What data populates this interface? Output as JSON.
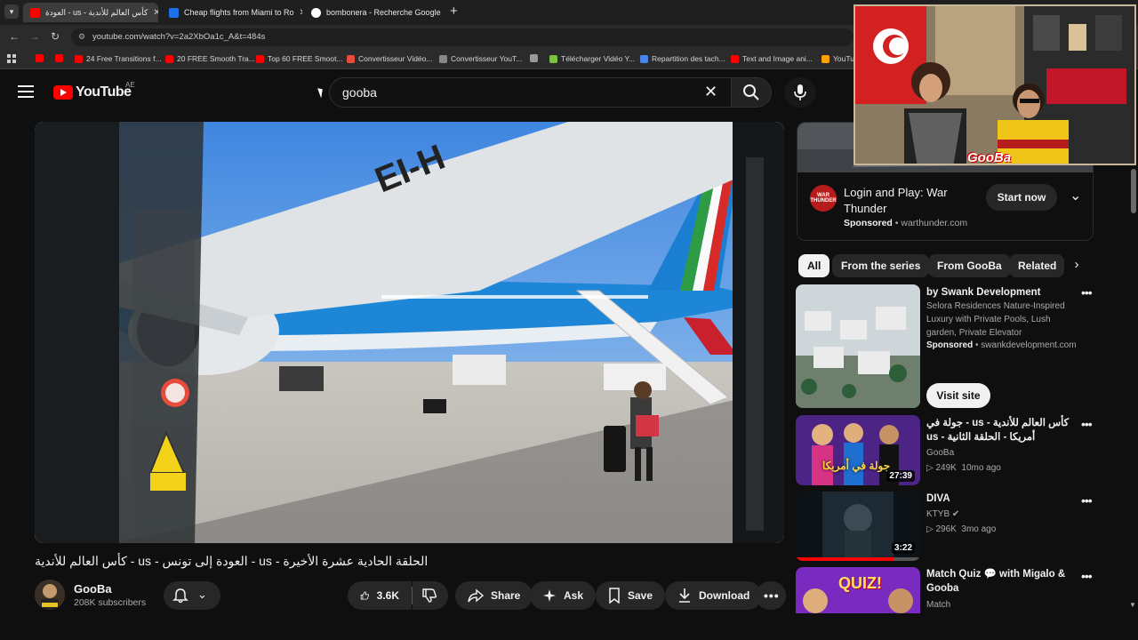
{
  "browser": {
    "tabs": [
      {
        "title": "كأس العالم للأندية - us - العودة",
        "active": true,
        "favicon_color": "#ff0000"
      },
      {
        "title": "Cheap flights from Miami to Ro",
        "active": false,
        "favicon_color": "#1a73e8"
      },
      {
        "title": "bombonera - Recherche Google",
        "active": false,
        "favicon_color": "#ffffff"
      }
    ],
    "new_tab": "+",
    "url": "youtube.com/watch?v=2a2XbOa1c_A&t=484s",
    "bookmarks": [
      {
        "label": "",
        "color": "#ff0000"
      },
      {
        "label": "",
        "color": "#ff0000"
      },
      {
        "label": "24 Free Transitions f...",
        "color": "#ff0000"
      },
      {
        "label": "20 FREE Smooth Tra...",
        "color": "#ff0000"
      },
      {
        "label": "Top 60 FREE Smoot...",
        "color": "#ff0000"
      },
      {
        "label": "Convertisseur Vidéo...",
        "color": "#e84c3d"
      },
      {
        "label": "Convertisseur YouT...",
        "color": "#888888"
      },
      {
        "label": "",
        "color": "#999999"
      },
      {
        "label": "Télécharger Vidéo Y...",
        "color": "#7cc242"
      },
      {
        "label": "Repartition des tach...",
        "color": "#4a86e8"
      },
      {
        "label": "Text and Image ani...",
        "color": "#ff0000"
      },
      {
        "label": "YouTu",
        "color": "#ffa000"
      }
    ]
  },
  "header": {
    "logo": "YouTube",
    "region": "AE",
    "search_value": "gooba"
  },
  "video": {
    "title": "الحلقة الحادية عشرة الأخيرة - us - العودة إلى تونس - us - كأس العالم للأندية",
    "tail_text": "EI-H",
    "channel": "GooBa",
    "subscribers": "208K subscribers",
    "likes": "3.6K",
    "share": "Share",
    "ask": "Ask",
    "save": "Save",
    "download": "Download"
  },
  "ad": {
    "title": "Login and Play: War Thunder",
    "sponsored": "Sponsored",
    "domain": "warthunder.com",
    "cta": "Start now",
    "logo_text": "WAR THUNDER"
  },
  "chips": [
    "All",
    "From the series",
    "From GooBa",
    "Related"
  ],
  "related": [
    {
      "title": "by Swank Development",
      "desc": "Selora Residences Nature-Inspired Luxury with Private Pools, Lush garden, Private Elevator",
      "sponsored": "Sponsored",
      "domain": "swankdevelopment.com",
      "cta": "Visit site"
    },
    {
      "title": "كأس العالم للأندية - us - جولة في أمريكا - الحلقة الثانية - us",
      "channel": "GooBa",
      "meta": "249K views · 10mo ago",
      "meta_views": "249K",
      "meta_age": "10mo ago",
      "duration": "27:39",
      "thumb_text": "جولة في أمريكا"
    },
    {
      "title": "DIVA",
      "channel": "KTYB",
      "meta_views": "296K",
      "meta_age": "3mo ago",
      "duration": "3:22"
    },
    {
      "title": "Match Quiz 💬 with Migalo & Gooba",
      "channel": "Match",
      "thumb_text": "QUIZ!"
    }
  ],
  "webcam": {
    "label": "GooBa"
  }
}
